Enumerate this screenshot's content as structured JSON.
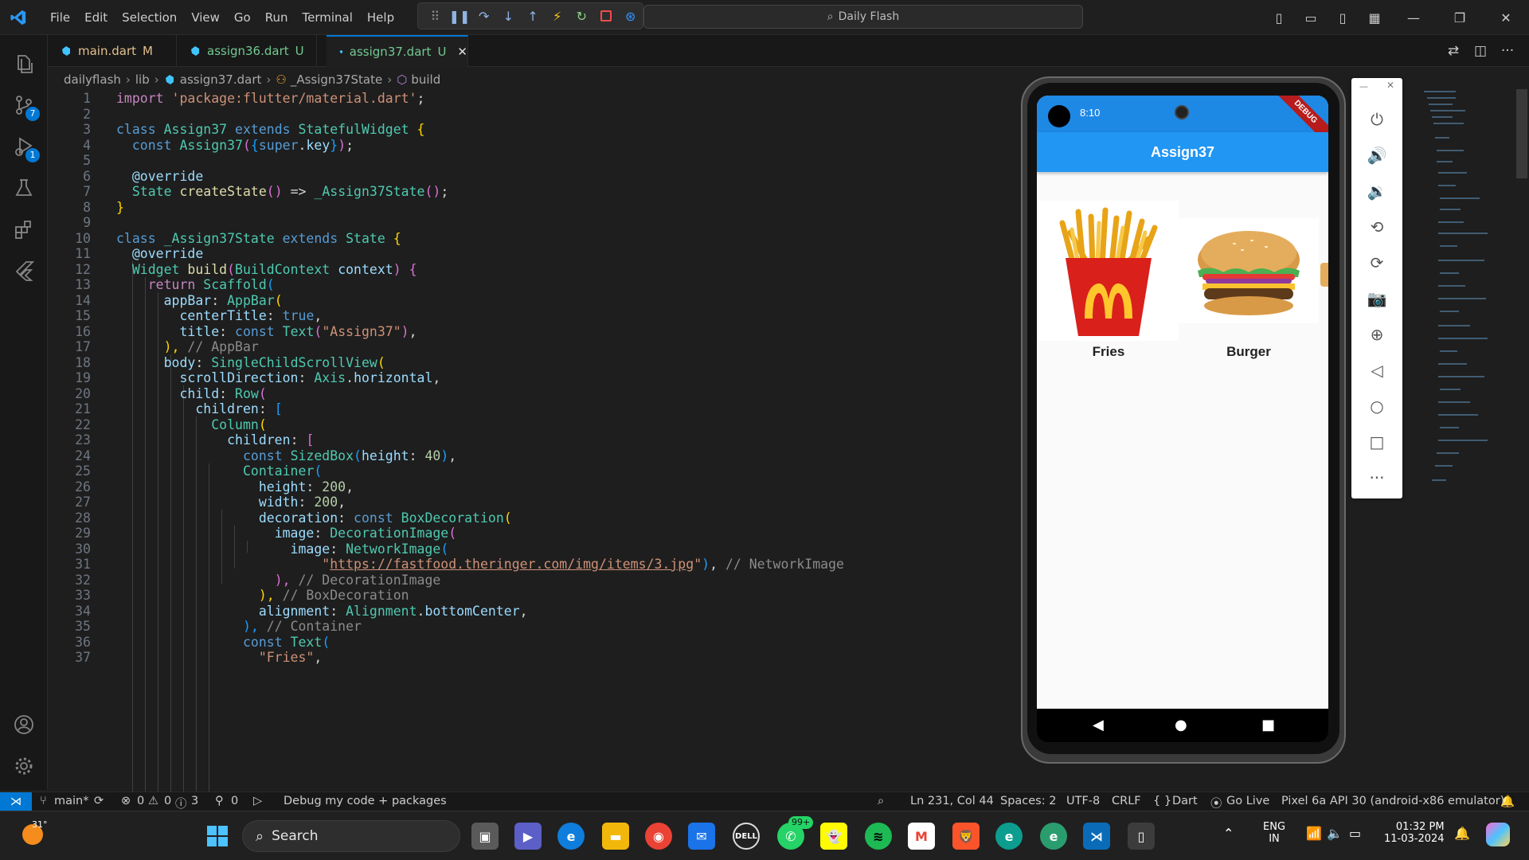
{
  "window": {
    "menu": [
      "File",
      "Edit",
      "Selection",
      "View",
      "Go",
      "Run",
      "Terminal",
      "Help"
    ],
    "search_title": "Daily Flash"
  },
  "activity_badges": {
    "source_control": "7",
    "run_debug": "1"
  },
  "tabs": [
    {
      "label": "main.dart",
      "status": "M"
    },
    {
      "label": "assign36.dart",
      "status": "U"
    },
    {
      "label": "assign37.dart",
      "status": "U",
      "active": true
    }
  ],
  "breadcrumb": [
    "dailyflash",
    "lib",
    "assign37.dart",
    "_Assign37State",
    "build"
  ],
  "code_lines": [
    "1",
    "2",
    "3",
    "4",
    "5",
    "6",
    "7",
    "8",
    "9",
    "10",
    "11",
    "12",
    "13",
    "14",
    "15",
    "16",
    "17",
    "18",
    "19",
    "20",
    "21",
    "22",
    "23",
    "24",
    "25",
    "26",
    "27",
    "28",
    "29",
    "30",
    "31",
    "32",
    "33",
    "34",
    "35",
    "36",
    "37"
  ],
  "code_text": {
    "l1a": "import",
    "l1b": "'package:flutter/material.dart'",
    "l1c": ";",
    "l3": [
      "class",
      "Assign37",
      "extends",
      "StatefulWidget",
      "{"
    ],
    "l4": [
      "const",
      "Assign37",
      "(",
      "{",
      "super",
      ".",
      "key",
      "}",
      ")",
      ";"
    ],
    "l6": "@override",
    "l7": [
      "State",
      "createState",
      "()",
      " => ",
      "_Assign37State",
      "()",
      ";"
    ],
    "l8": "}",
    "l10": [
      "class",
      "_Assign37State",
      "extends",
      "State",
      "{"
    ],
    "l11": "@override",
    "l12": [
      "Widget",
      "build",
      "(",
      "BuildContext",
      "context",
      ")",
      "{"
    ],
    "l13": [
      "return",
      "Scaffold",
      "("
    ],
    "l14": [
      "appBar",
      ": ",
      "AppBar",
      "("
    ],
    "l15": [
      "centerTitle",
      ": ",
      "true",
      ","
    ],
    "l16": [
      "title",
      ": ",
      "const",
      "Text",
      "(",
      "\"Assign37\"",
      ")",
      ","
    ],
    "l17": [
      "),",
      "// AppBar"
    ],
    "l18": [
      "body",
      ": ",
      "SingleChildScrollView",
      "("
    ],
    "l19": [
      "scrollDirection",
      ": ",
      "Axis",
      ".",
      "horizontal",
      ","
    ],
    "l20": [
      "child",
      ": ",
      "Row",
      "("
    ],
    "l21": [
      "children",
      ": ",
      "["
    ],
    "l22": [
      "Column",
      "("
    ],
    "l23": [
      "children",
      ": ",
      "["
    ],
    "l24": [
      "const",
      "SizedBox",
      "(",
      "height",
      ": ",
      "40",
      ")",
      ","
    ],
    "l25": [
      "Container",
      "("
    ],
    "l26": [
      "height",
      ": ",
      "200",
      ","
    ],
    "l27": [
      "width",
      ": ",
      "200",
      ","
    ],
    "l28": [
      "decoration",
      ": ",
      "const",
      "BoxDecoration",
      "("
    ],
    "l29": [
      "image",
      ": ",
      "DecorationImage",
      "("
    ],
    "l30": [
      "image",
      ": ",
      "NetworkImage",
      "("
    ],
    "l31": [
      "\"",
      "https://fastfood.theringer.com/img/items/3.jpg",
      "\"",
      ")",
      ",",
      "// NetworkImage"
    ],
    "l32": [
      "),",
      "// DecorationImage"
    ],
    "l33": [
      "),",
      "// BoxDecoration"
    ],
    "l34": [
      "alignment",
      ": ",
      "Alignment",
      ".",
      "bottomCenter",
      ","
    ],
    "l35": [
      "),",
      "// Container"
    ],
    "l36": [
      "const",
      "Text",
      "("
    ],
    "l37": [
      "\"Fries\"",
      ","
    ]
  },
  "emulator": {
    "time": "8:10",
    "debug_banner": "DEBUG",
    "app_title": "Assign37",
    "items": [
      {
        "label": "Fries",
        "image": "mcdonalds-fries"
      },
      {
        "label": "Burger",
        "image": "burger"
      }
    ]
  },
  "statusbar": {
    "branch": "main*",
    "errors": "0",
    "warnings": "0",
    "infos": "3",
    "ports": "0",
    "debug_config": "Debug my code + packages",
    "cursor": "Ln 231, Col 44",
    "spaces": "Spaces: 2",
    "encoding": "UTF-8",
    "eol": "CRLF",
    "language": "Dart",
    "go_live": "Go Live",
    "device": "Pixel 6a API 30 (android-x86 emulator)"
  },
  "taskbar": {
    "weather": "31°",
    "search": "Search",
    "whatsapp_badge": "99+",
    "lang": "ENG",
    "region": "IN",
    "time": "01:32 PM",
    "date": "11-03-2024"
  },
  "colors": {
    "accent": "#0078d4",
    "appbar": "#2196f3",
    "editor_bg": "#1e1e1e"
  }
}
